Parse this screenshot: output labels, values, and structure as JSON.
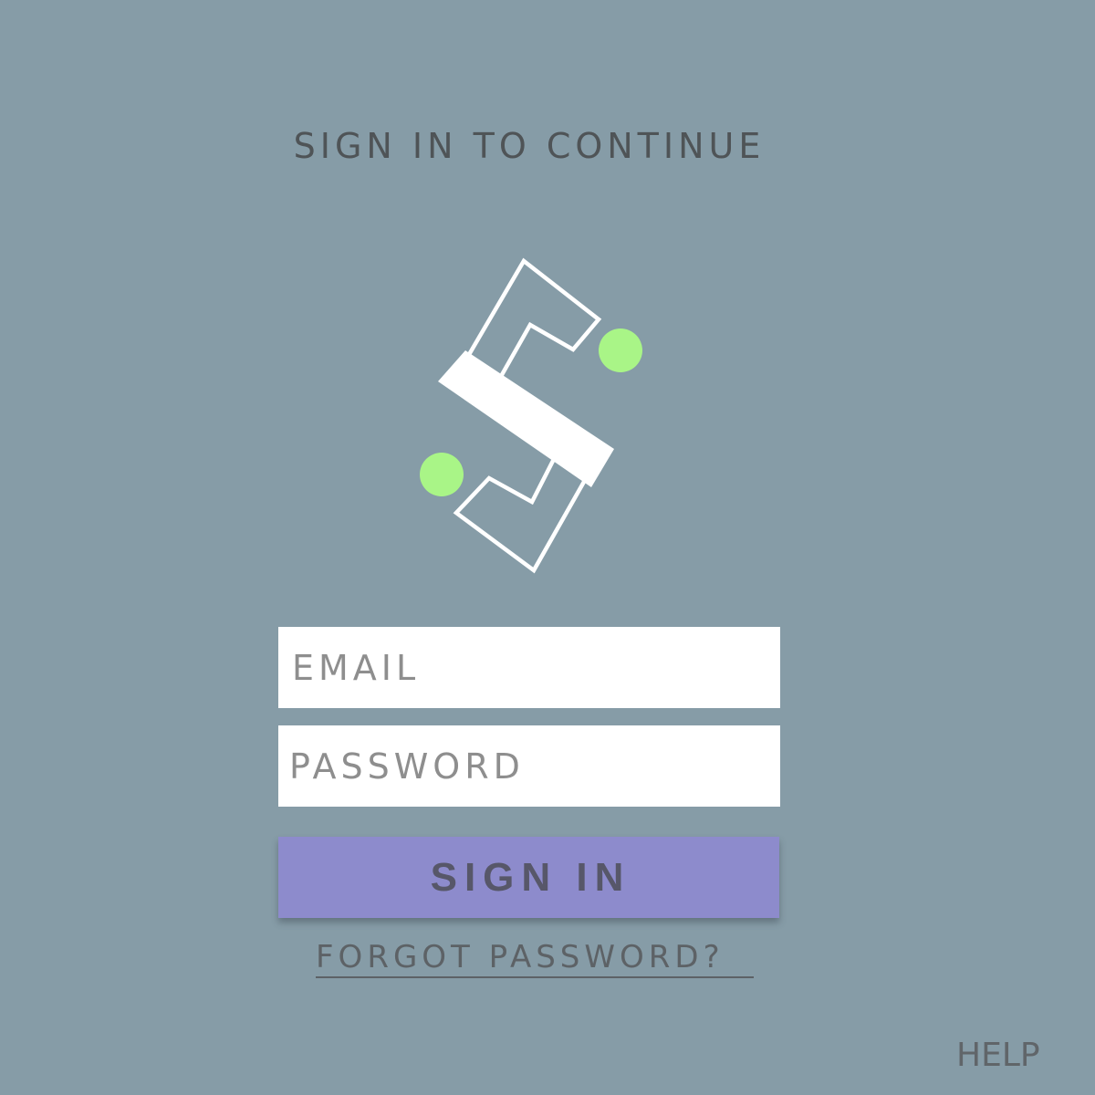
{
  "screen": {
    "background_color": "#869ca7"
  },
  "header": {
    "title": "SIGN IN TO CONTINUE"
  },
  "logo": {
    "icon": "s-logo-icon",
    "stroke_color": "#ffffff",
    "dot_color": "#a9f587"
  },
  "form": {
    "email": {
      "placeholder": "EMAIL",
      "value": ""
    },
    "password": {
      "placeholder": "PASSWORD",
      "value": ""
    },
    "submit": {
      "label": "SIGN IN",
      "color": "#8d8bcc"
    },
    "forgot_link": "FORGOT PASSWORD?"
  },
  "footer": {
    "help_label": "HELP"
  }
}
